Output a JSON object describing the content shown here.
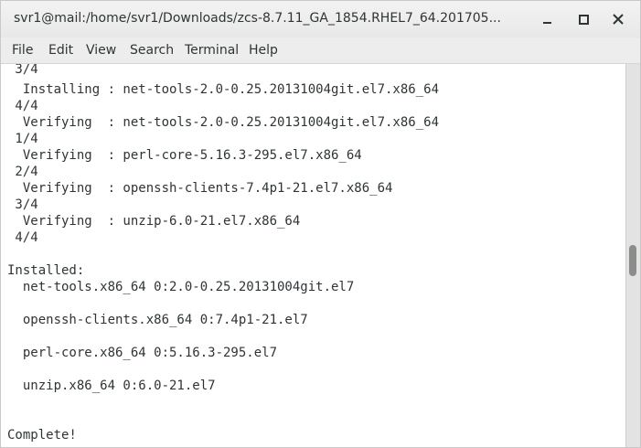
{
  "window": {
    "title": "svr1@mail:/home/svr1/Downloads/zcs-8.7.11_GA_1854.RHEL7_64.201705..."
  },
  "menu": {
    "items": [
      "File",
      "Edit",
      "View",
      "Search",
      "Terminal",
      "Help"
    ]
  },
  "terminal": {
    "lines": [
      " 3/4",
      "  Installing : net-tools-2.0-0.25.20131004git.el7.x86_64",
      " 4/4",
      "  Verifying  : net-tools-2.0-0.25.20131004git.el7.x86_64",
      " 1/4",
      "  Verifying  : perl-core-5.16.3-295.el7.x86_64",
      " 2/4",
      "  Verifying  : openssh-clients-7.4p1-21.el7.x86_64",
      " 3/4",
      "  Verifying  : unzip-6.0-21.el7.x86_64",
      " 4/4",
      "",
      "Installed:",
      "  net-tools.x86_64 0:2.0-0.25.20131004git.el7",
      "",
      "  openssh-clients.x86_64 0:7.4p1-21.el7",
      "",
      "  perl-core.x86_64 0:5.16.3-295.el7",
      "",
      "  unzip.x86_64 0:6.0-21.el7",
      "",
      "",
      "Complete!"
    ]
  },
  "colors": {
    "text": "#2e3436",
    "terminal_bg": "#ffffff",
    "chrome_bg": "#ededed"
  }
}
